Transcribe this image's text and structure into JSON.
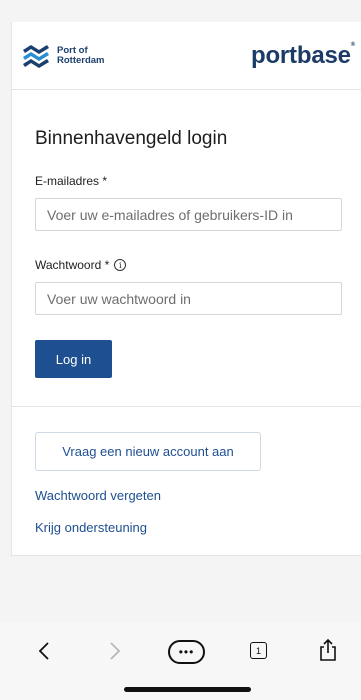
{
  "header": {
    "por_logo_line1": "Port of",
    "por_logo_line2": "Rotterdam",
    "portbase_logo": "portbase"
  },
  "form": {
    "title": "Binnenhavengeld login",
    "email_label": "E-mailadres *",
    "email_placeholder": "Voer uw e-mailadres of gebruikers-ID in",
    "password_label": "Wachtwoord *",
    "password_placeholder": "Voer uw wachtwoord in",
    "login_button": "Log in"
  },
  "secondary": {
    "new_account_button": "Vraag een nieuw account aan",
    "forgot_password_link": "Wachtwoord vergeten",
    "support_link": "Krijg ondersteuning"
  },
  "browser_toolbar": {
    "tab_count": "1",
    "icons": [
      "back-icon",
      "forward-icon",
      "more-icon",
      "tabs-icon",
      "share-icon"
    ]
  },
  "colors": {
    "primary": "#1d4f91",
    "brand_dark": "#1c3b66",
    "accent": "#f0a020"
  }
}
